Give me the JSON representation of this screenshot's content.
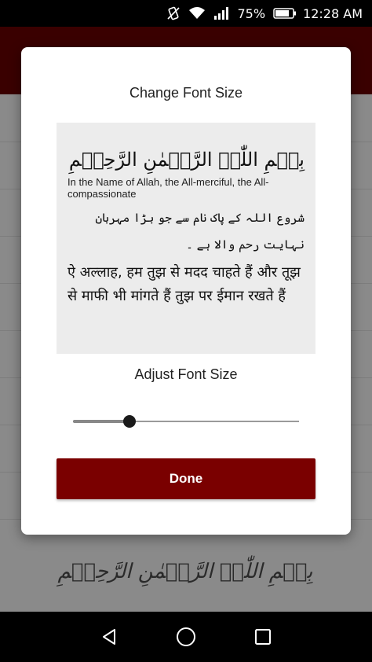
{
  "status_bar": {
    "battery_percent": "75%",
    "time": "12:28 AM",
    "icons": [
      "vibrate-icon",
      "wifi-icon",
      "signal-icon",
      "battery-icon"
    ]
  },
  "background": {
    "verse": "بِسۡمِ اللّٰہِ الرَّحۡمٰنِ الرَّحِیۡمِ"
  },
  "dialog": {
    "title": "Change Font Size",
    "preview": {
      "arabic": "بِسۡمِ اللّٰہِ الرَّحۡمٰنِ الرَّحِیۡمِ",
      "english": "In the Name of Allah, the All-merciful, the All-compassionate",
      "urdu": "شروع اللہ کے پاک نام سے جو بڑا مہربان نہایت رحم والا ہے ۔",
      "hindi": "ऐ अल्लाह,  हम तुझ से मदद चाहते हैं और तूझ से माफी भी मांगते हैं तुझ पर ईमान रखते हैं"
    },
    "adjust_label": "Adjust Font Size",
    "slider_fraction": 0.25,
    "done_label": "Done"
  },
  "colors": {
    "accent": "#7a0000",
    "status_bar": "#000000",
    "preview_bg": "#ececec"
  },
  "nav_bar": {
    "icons": [
      "back-icon",
      "home-icon",
      "recents-icon"
    ]
  }
}
